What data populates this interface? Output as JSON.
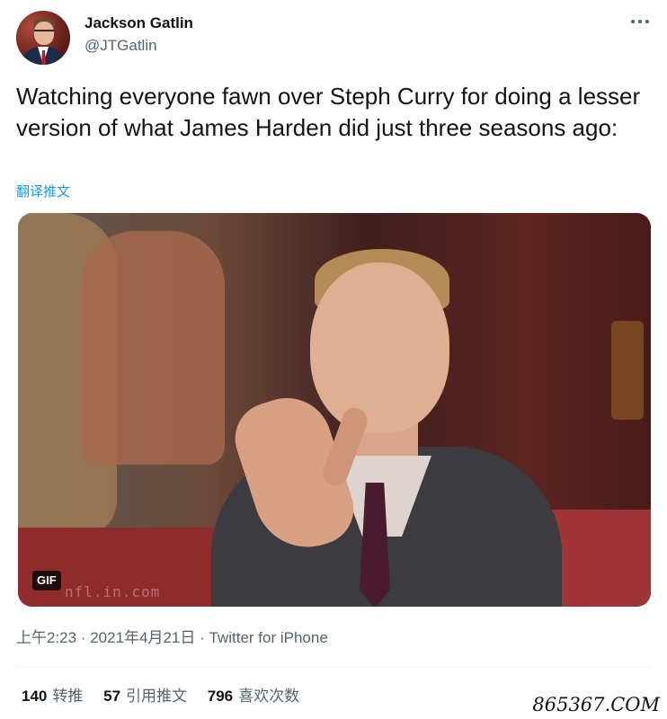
{
  "author": {
    "name": "Jackson Gatlin",
    "handle": "@JTGatlin"
  },
  "tweet": {
    "text": "Watching everyone fawn over Steph Curry for doing a lesser version of what James Harden did just three seasons ago:",
    "translate_label": "翻译推文",
    "media_badge": "GIF",
    "media_watermark": "nfl.in.com"
  },
  "meta": {
    "time": "上午2:23",
    "separator": " · ",
    "date": "2021年4月21日",
    "source": "Twitter for iPhone"
  },
  "stats": {
    "retweets_count": "140",
    "retweets_label": "转推",
    "quotes_count": "57",
    "quotes_label": "引用推文",
    "likes_count": "796",
    "likes_label": "喜欢次数"
  },
  "watermark": "865367.COM",
  "icons": {
    "more": "more-horizontal-icon"
  }
}
